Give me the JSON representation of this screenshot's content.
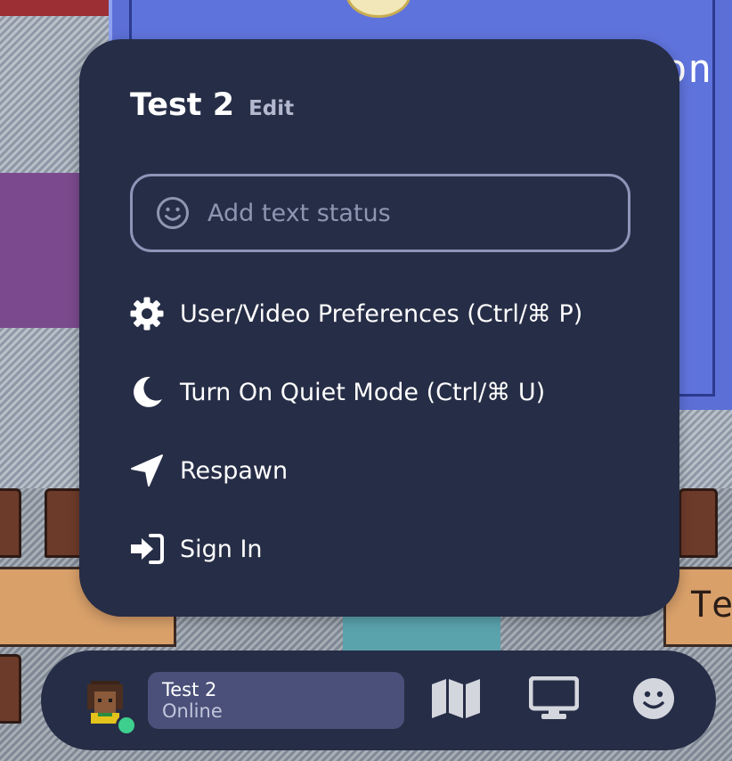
{
  "background": {
    "board_text": "on",
    "table_text": "Te"
  },
  "menu": {
    "user_name": "Test 2",
    "edit_label": "Edit",
    "status_placeholder": "Add text status",
    "items": [
      {
        "icon": "gear-icon",
        "label": "User/Video Preferences (Ctrl/⌘ P)"
      },
      {
        "icon": "moon-icon",
        "label": "Turn On Quiet Mode (Ctrl/⌘ U)"
      },
      {
        "icon": "location-arrow-icon",
        "label": "Respawn"
      },
      {
        "icon": "sign-in-icon",
        "label": "Sign In"
      }
    ]
  },
  "bottom_bar": {
    "user_name": "Test 2",
    "user_status": "Online",
    "buttons": [
      "map-icon",
      "screen-share-icon",
      "emoji-icon"
    ]
  },
  "colors": {
    "panel": "#262d46",
    "pill": "#4a5079",
    "online": "#3ecf8e",
    "muted_text": "#8f96b2"
  }
}
